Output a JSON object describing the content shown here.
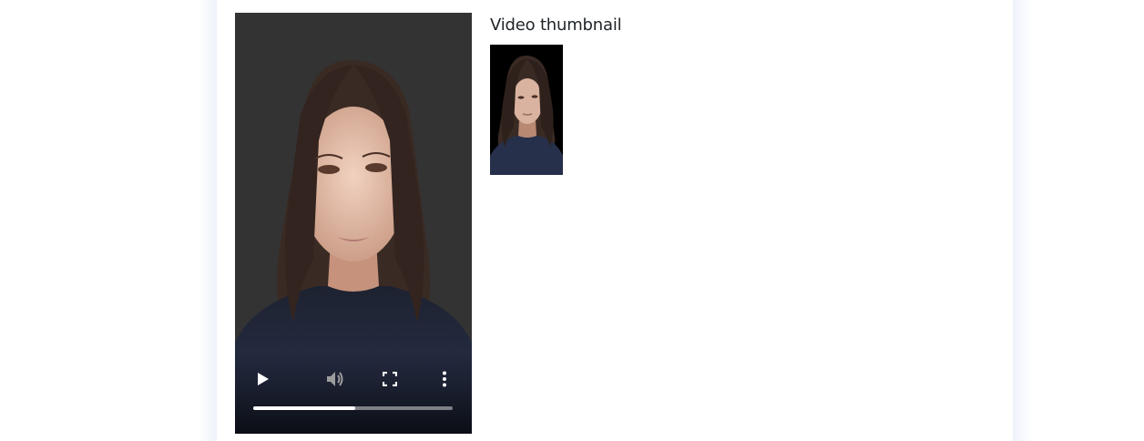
{
  "thumbnail_section": {
    "title": "Video thumbnail"
  },
  "video_player": {
    "progress_fraction": 0.51,
    "controls": {
      "play_icon": "play-icon",
      "volume_icon": "volume-icon",
      "fullscreen_icon": "fullscreen-icon",
      "more_icon": "more-vertical-icon"
    },
    "colors": {
      "background": "#333333",
      "progress_fill": "#ffffff",
      "progress_track": "#9a9a9a"
    }
  }
}
